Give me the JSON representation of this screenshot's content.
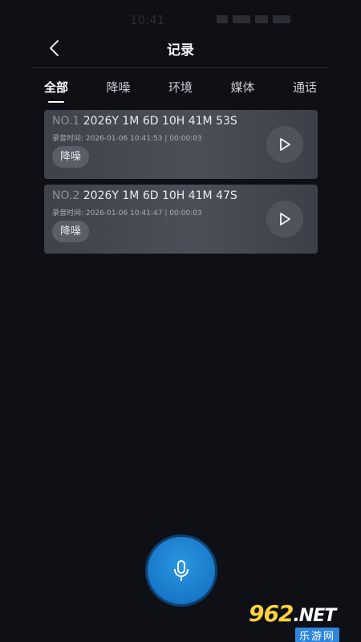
{
  "status_bar": {
    "time": "10:41"
  },
  "header": {
    "title": "记录"
  },
  "tabs": [
    {
      "label": "全部",
      "active": true
    },
    {
      "label": "降噪",
      "active": false
    },
    {
      "label": "环境",
      "active": false
    },
    {
      "label": "媒体",
      "active": false
    },
    {
      "label": "通话",
      "active": false
    }
  ],
  "records": [
    {
      "no": "NO.1",
      "name": "2026Y 1M 6D 10H 41M 53S",
      "meta": "录音时间: 2026-01-06 10:41:53 | 00:00:03",
      "tag": "降噪"
    },
    {
      "no": "NO.2",
      "name": "2026Y 1M 6D 10H 41M 47S",
      "meta": "录音时间: 2026-01-06 10:41:47 | 00:00:03",
      "tag": "降噪"
    }
  ],
  "icons": {
    "back": "chevron-left-icon",
    "play": "play-icon",
    "mic": "microphone-icon"
  },
  "watermark": {
    "logo": "962",
    "net": ".NET",
    "sub": "乐游网"
  },
  "colors": {
    "background": "#0e1016",
    "card": "#464b53",
    "mic_button": "#1e88d8",
    "watermark_yellow": "#ffd23a"
  }
}
